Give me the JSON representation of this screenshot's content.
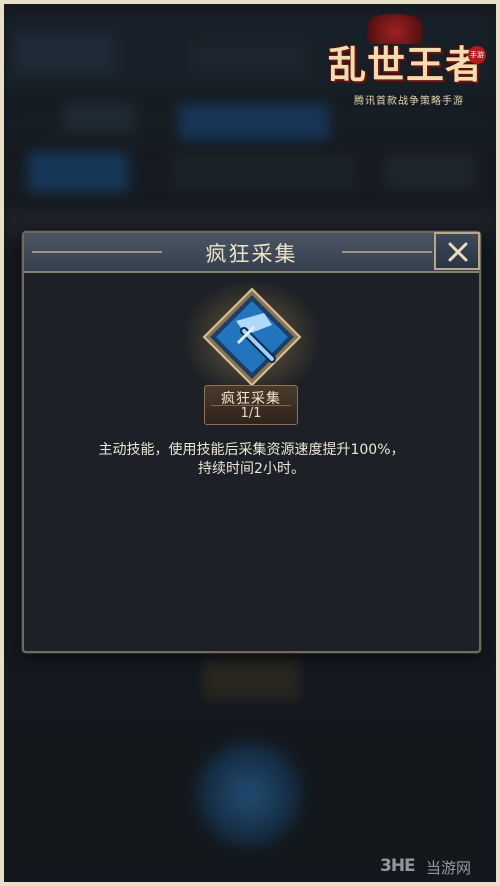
{
  "logo": {
    "title": "乱世王者",
    "subtitle": "腾讯首款战争策略手游",
    "seal": "手游"
  },
  "dialog": {
    "title": "疯狂采集",
    "close_icon": "close-x-icon"
  },
  "skill": {
    "name": "疯狂采集",
    "count": "1/1",
    "icon": "gather-tool-icon",
    "description_line1": "主动技能，使用技能后采集资源速度提升100%，",
    "description_line2": "持续时间2小时。"
  },
  "watermark": {
    "logo": "3HE",
    "text": "当游网"
  },
  "colors": {
    "dialog_bg": "#1d2127",
    "header_bg": "#3e4856",
    "gold_border": "#b9a983",
    "text_light": "#ece6d6",
    "icon_blue": "#1f6fb5"
  }
}
